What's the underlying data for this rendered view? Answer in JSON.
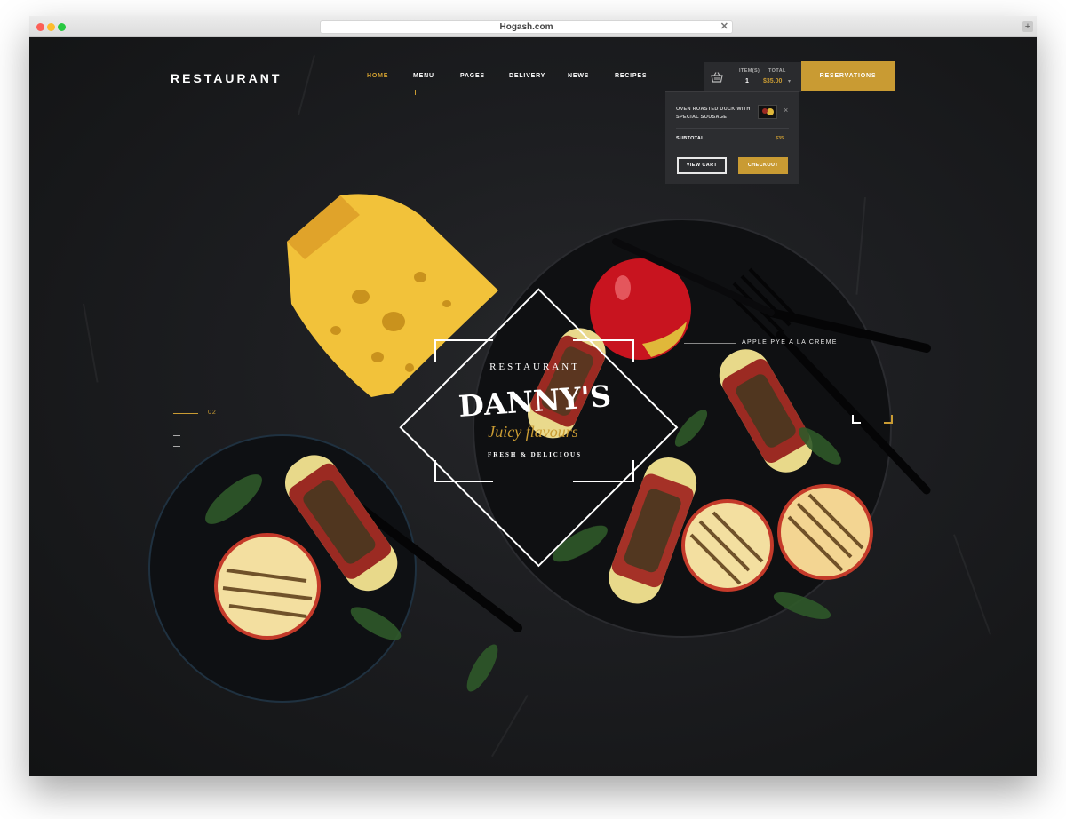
{
  "browser": {
    "url": "Hogash.com"
  },
  "header": {
    "logo": "RESTAURANT",
    "nav": [
      {
        "label": "HOME",
        "active": true
      },
      {
        "label": "MENU",
        "active": false
      },
      {
        "label": "PAGES",
        "active": false
      },
      {
        "label": "DELIVERY",
        "active": false
      },
      {
        "label": "NEWS",
        "active": false
      },
      {
        "label": "RECIPES",
        "active": false
      }
    ],
    "cart": {
      "items_label": "ITEM(S)",
      "items_value": "1",
      "total_label": "TOTAL",
      "total_value": "$35.00",
      "icon": "basket-icon"
    },
    "reservations_label": "RESERVATIONS"
  },
  "cart_dropdown": {
    "item_name": "OVEN ROASTED DUCK WITH SPECIAL SOUSAGE",
    "remove_icon": "×",
    "subtotal_label": "SUBTOTAL",
    "subtotal_value": "$35",
    "view_cart_label": "VIEW CART",
    "checkout_label": "CHECKOUT"
  },
  "hero": {
    "brand_top": "RESTAURANT",
    "brand_name": "DANNY'S",
    "tagline": "Juicy flavours",
    "subline": "FRESH & DELICIOUS",
    "slide_number": "02",
    "slide_caption": "APPLE PYE A LA CREME"
  },
  "colors": {
    "accent": "#c99b33",
    "background": "#1a1b1d"
  }
}
